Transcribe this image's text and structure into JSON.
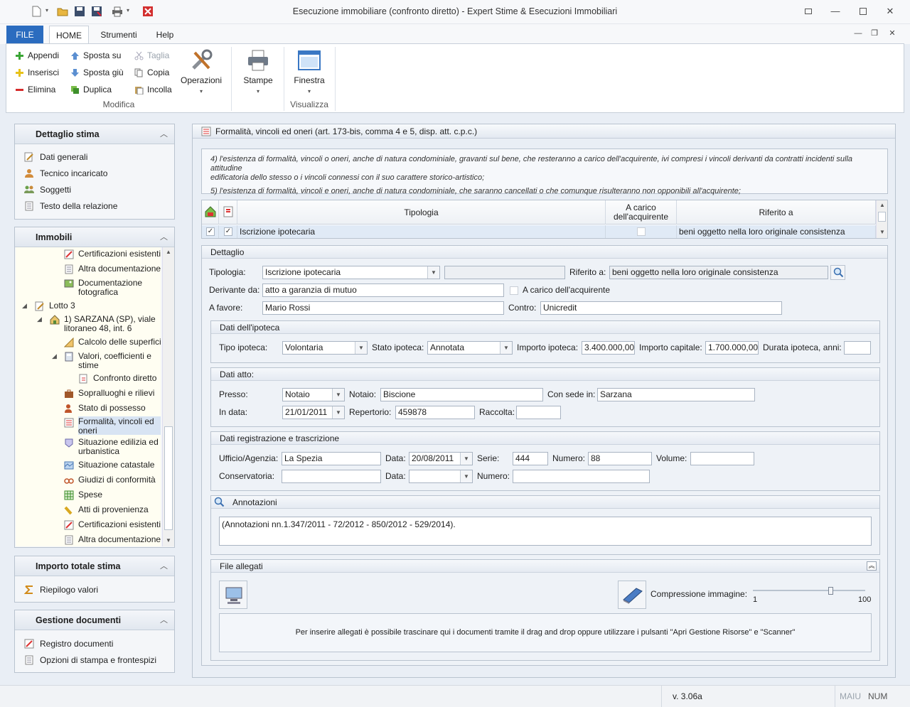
{
  "window": {
    "title": "Esecuzione immobiliare (confronto diretto) - Expert Stime & Esecuzioni Immobiliari"
  },
  "menu": {
    "file": "FILE",
    "tabs": [
      "HOME",
      "Strumenti",
      "Help"
    ]
  },
  "ribbon": {
    "modifica": {
      "append": "Appendi",
      "insert": "Inserisci",
      "delete": "Elimina",
      "move_up": "Sposta su",
      "move_down": "Sposta giù",
      "duplicate": "Duplica",
      "cut": "Taglia",
      "copy": "Copia",
      "paste": "Incolla",
      "operations": "Operazioni",
      "group": "Modifica"
    },
    "stampe": "Stampe",
    "finestra": "Finestra",
    "visualizza": "Visualizza"
  },
  "sidebar": {
    "dettaglio": {
      "title": "Dettaglio stima",
      "items": [
        "Dati generali",
        "Tecnico incaricato",
        "Soggetti",
        "Testo della relazione"
      ]
    },
    "immobili": {
      "title": "Immobili",
      "tree": [
        "Certificazioni esistenti",
        "Altra documentazione",
        "Documentazione fotografica",
        "Lotto 3",
        "1) SARZANA (SP), viale litoraneo 48, int. 6",
        "Calcolo delle superfici",
        "Valori, coefficienti e stime",
        "Confronto diretto",
        "Sopralluoghi e rilievi",
        "Stato di possesso",
        "Formalità, vincoli ed oneri",
        "Situazione edilizia ed urbanistica",
        "Situazione catastale",
        "Giudizi di conformità",
        "Spese",
        "Atti di provenienza",
        "Certificazioni esistenti",
        "Altra documentazione"
      ]
    },
    "importo": {
      "title": "Importo totale stima",
      "items": [
        "Riepilogo valori"
      ]
    },
    "documenti": {
      "title": "Gestione documenti",
      "items": [
        "Registro documenti",
        "Opzioni di stampa e frontespizi"
      ]
    }
  },
  "main": {
    "header": "Formalità, vincoli ed oneri (art. 173-bis, comma 4 e 5, disp. att. c.p.c.)",
    "info_line1": "4) l'esistenza di formalità, vincoli o oneri, anche di natura condominiale, gravanti sul bene, che resteranno a carico dell'acquirente, ivi compresi i vincoli derivanti da contratti incidenti sulla attitudine",
    "info_line2": "edificatoria dello stesso o i vincoli connessi con il suo carattere storico-artistico;",
    "info_line3": "5) l'esistenza di formalità, vincoli e oneri, anche di natura condominiale, che saranno cancellati o che comunque risulteranno non opponibili all'acquirente;",
    "grid": {
      "headers": {
        "tipologia": "Tipologia",
        "carico": "A carico dell'acquirente",
        "riferito": "Riferito a"
      },
      "row": {
        "tipologia": "Iscrizione ipotecaria",
        "riferito": "beni oggetto nella loro originale consistenza"
      }
    },
    "dettaglio": {
      "title": "Dettaglio",
      "tipologia_label": "Tipologia:",
      "tipologia": "Iscrizione ipotecaria",
      "riferito_label": "Riferito a:",
      "riferito": "beni oggetto nella loro originale consistenza",
      "derivante_label": "Derivante da:",
      "derivante": "atto a garanzia di mutuo",
      "carico_label": "A carico dell'acquirente",
      "favore_label": "A favore:",
      "favore": "Mario Rossi",
      "contro_label": "Contro:",
      "contro": "Unicredit"
    },
    "ipoteca": {
      "title": "Dati dell'ipoteca",
      "tipo_label": "Tipo ipoteca:",
      "tipo": "Volontaria",
      "stato_label": "Stato ipoteca:",
      "stato": "Annotata",
      "importo_label": "Importo ipoteca:",
      "importo": "3.400.000,00",
      "capitale_label": "Importo capitale:",
      "capitale": "1.700.000,00",
      "durata_label": "Durata ipoteca, anni:",
      "durata": ""
    },
    "atto": {
      "title": "Dati atto:",
      "presso_label": "Presso:",
      "presso": "Notaio",
      "notaio_label": "Notaio:",
      "notaio": "Biscione",
      "sede_label": "Con sede in:",
      "sede": "Sarzana",
      "data_label": "In data:",
      "data": "21/01/2011",
      "repertorio_label": "Repertorio:",
      "repertorio": "459878",
      "raccolta_label": "Raccolta:",
      "raccolta": ""
    },
    "registrazione": {
      "title": "Dati registrazione e trascrizione",
      "ufficio_label": "Ufficio/Agenzia:",
      "ufficio": "La Spezia",
      "data_label": "Data:",
      "data": "20/08/2011",
      "serie_label": "Serie:",
      "serie": "444",
      "numero_label": "Numero:",
      "numero": "88",
      "volume_label": "Volume:",
      "volume": "",
      "conservatoria_label": "Conservatoria:",
      "conservatoria": "",
      "data2_label": "Data:",
      "data2": "",
      "numero2_label": "Numero:",
      "numero2": ""
    },
    "annotazioni": {
      "title": "Annotazioni",
      "text": "(Annotazioni nn.1.347/2011 - 72/2012 - 850/2012 - 529/2014)."
    },
    "allegati": {
      "title": "File allegati",
      "compression_label": "Compressione immagine:",
      "slider_min": "1",
      "slider_max": "100",
      "slider_value": 70,
      "drop_text": "Per inserire allegati è possibile trascinare qui i documenti tramite il drag and drop oppure utilizzare i pulsanti \"Apri Gestione Risorse\" e \"Scanner\""
    }
  },
  "status": {
    "version": "v. 3.06a",
    "maiu": "MAIU",
    "num": "NUM"
  }
}
